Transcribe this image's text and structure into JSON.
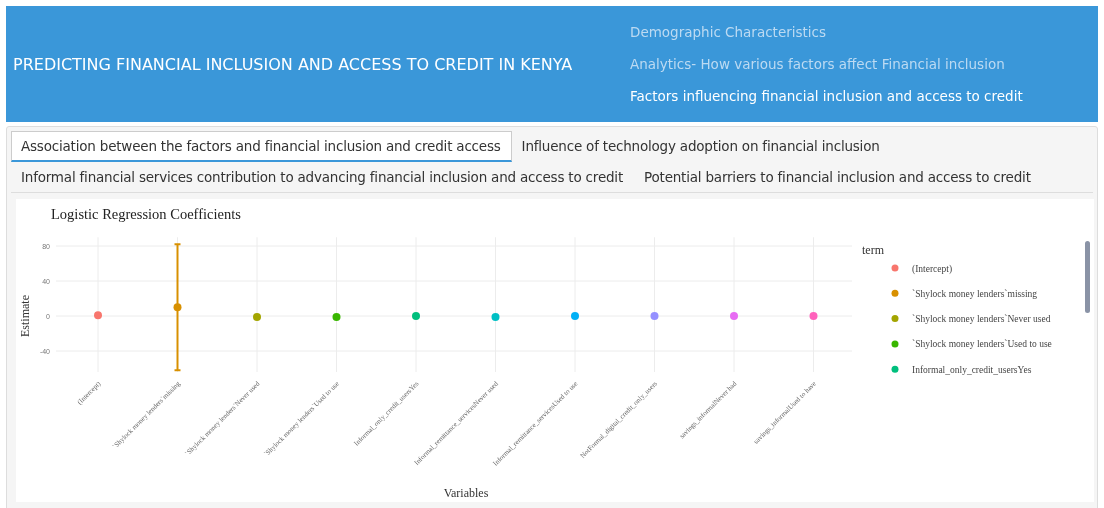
{
  "header": {
    "title": "PREDICTING FINANCIAL INCLUSION AND ACCESS TO CREDIT IN KENYA",
    "nav": [
      {
        "label": "Demographic Characteristics",
        "selected": false
      },
      {
        "label": "Analytics- How various factors affect Financial inclusion",
        "selected": false
      },
      {
        "label": "Factors influencing financial inclusion and access to credit",
        "selected": true
      }
    ]
  },
  "tabs": [
    [
      {
        "label": "Association between the factors and financial inclusion and credit access",
        "selected": true
      },
      {
        "label": "Influence of technology adoption on financial inclusion",
        "selected": false
      }
    ],
    [
      {
        "label": "Informal financial services contribution to advancing financial inclusion and access to credit",
        "selected": false
      },
      {
        "label": "Potential barriers to financial inclusion and access to credit",
        "selected": false
      }
    ]
  ],
  "chart": {
    "chart_data": {
      "type": "scatter",
      "title": "Logistic Regression Coefficients",
      "xlabel": "Variables",
      "ylabel": "Estimate",
      "categories": [
        "(Intercept)",
        "`Shylock money lenders`missing",
        "`Shylock money lenders`Never used",
        "`Shylock money lenders`Used to use",
        "Informal_only_credit_usersYes",
        "Informal_remittance_servicesNever used",
        "Informal_remittance_servicesUsed to use",
        "NotFormal_digital_credit_only_users",
        "savings_informalNever had",
        "savings_informalUsed to have"
      ],
      "series": [
        {
          "name": "(Intercept)",
          "color": "#f8766d",
          "values": [
            1,
            null,
            null,
            null,
            null,
            null,
            null,
            null,
            null,
            null
          ]
        },
        {
          "name": "`Shylock money lenders`missing",
          "color": "#d89000",
          "values": [
            null,
            10,
            null,
            null,
            null,
            null,
            null,
            null,
            null,
            null
          ],
          "errors": [
            null,
            72,
            null,
            null,
            null,
            null,
            null,
            null,
            null,
            null
          ]
        },
        {
          "name": "`Shylock money lenders`Never used",
          "color": "#a3a500",
          "values": [
            null,
            null,
            -1,
            null,
            null,
            null,
            null,
            null,
            null,
            null
          ]
        },
        {
          "name": "`Shylock money lenders`Used to use",
          "color": "#39b600",
          "values": [
            null,
            null,
            null,
            -1,
            null,
            null,
            null,
            null,
            null,
            null
          ]
        },
        {
          "name": "Informal_only_credit_usersYes",
          "color": "#00bf7d",
          "values": [
            null,
            null,
            null,
            null,
            0,
            null,
            null,
            null,
            null,
            null
          ]
        },
        {
          "color": "#00bfc4",
          "values": [
            null,
            null,
            null,
            null,
            null,
            -1,
            null,
            null,
            null,
            null
          ]
        },
        {
          "color": "#00b0f6",
          "values": [
            null,
            null,
            null,
            null,
            null,
            null,
            0,
            null,
            null,
            null
          ]
        },
        {
          "color": "#9590ff",
          "values": [
            null,
            null,
            null,
            null,
            null,
            null,
            null,
            0,
            null,
            null
          ]
        },
        {
          "color": "#e76bf3",
          "values": [
            null,
            null,
            null,
            null,
            null,
            null,
            null,
            null,
            0,
            null
          ]
        },
        {
          "color": "#ff62bc",
          "values": [
            null,
            null,
            null,
            null,
            null,
            null,
            null,
            null,
            null,
            0
          ]
        }
      ],
      "ylim": [
        -64,
        90
      ],
      "yticks": [
        -40,
        0,
        40,
        80
      ],
      "grid": true,
      "legend": {
        "title": "term"
      }
    }
  }
}
